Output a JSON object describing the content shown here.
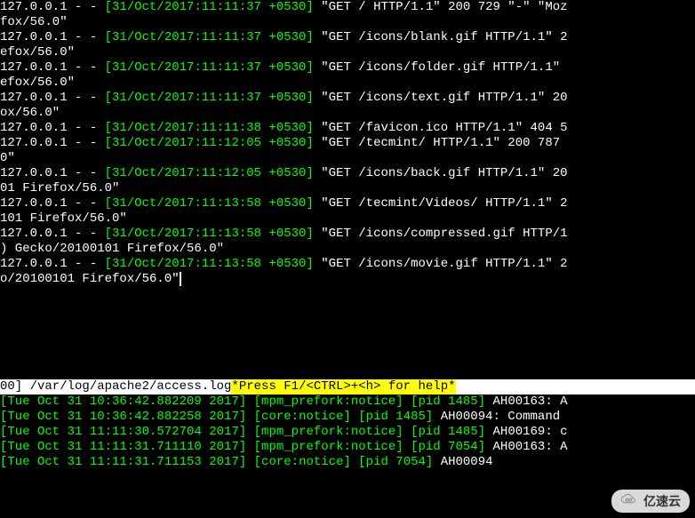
{
  "colors": {
    "bg": "#000000",
    "fg": "#ffffff",
    "green": "#00ff00",
    "status_bg": "#ffffff",
    "status_hl": "#ffff00"
  },
  "status_bar": {
    "left": "00] /var/log/apache2/access.log ",
    "right": "*Press F1/<CTRL>+<h> for help*"
  },
  "access_log": [
    {
      "prefix": "127.0.0.1 - - ",
      "timestamp": "[31/Oct/2017:11:11:37 +0530]",
      "tail": "  \"GET / HTTP/1.1\" 200 729 \"-\" \"Moz",
      "wrap": "fox/56.0\""
    },
    {
      "prefix": "127.0.0.1 - - ",
      "timestamp": "[31/Oct/2017:11:11:37 +0530]",
      "tail": "  \"GET /icons/blank.gif HTTP/1.1\" 2",
      "wrap": "efox/56.0\""
    },
    {
      "prefix": "127.0.0.1 - - ",
      "timestamp": "[31/Oct/2017:11:11:37 +0530]",
      "tail": "  \"GET /icons/folder.gif HTTP/1.1\" ",
      "wrap": "efox/56.0\""
    },
    {
      "prefix": "127.0.0.1 - - ",
      "timestamp": "[31/Oct/2017:11:11:37 +0530]",
      "tail": "  \"GET /icons/text.gif HTTP/1.1\" 20",
      "wrap": "ox/56.0\""
    },
    {
      "prefix": "127.0.0.1 - - ",
      "timestamp": "[31/Oct/2017:11:11:38 +0530]",
      "tail": "  \"GET /favicon.ico HTTP/1.1\" 404 5",
      "wrap": null
    },
    {
      "prefix": "127.0.0.1 - - ",
      "timestamp": "[31/Oct/2017:11:12:05 +0530]",
      "tail": "  \"GET /tecmint/ HTTP/1.1\" 200 787 ",
      "wrap": "0\""
    },
    {
      "prefix": "127.0.0.1 - - ",
      "timestamp": "[31/Oct/2017:11:12:05 +0530]",
      "tail": "  \"GET /icons/back.gif HTTP/1.1\" 20",
      "wrap": "01 Firefox/56.0\""
    },
    {
      "prefix": "127.0.0.1 - - ",
      "timestamp": "[31/Oct/2017:11:13:58 +0530]",
      "tail": "  \"GET /tecmint/Videos/ HTTP/1.1\" 2",
      "wrap": "101 Firefox/56.0\""
    },
    {
      "prefix": "127.0.0.1 - - ",
      "timestamp": "[31/Oct/2017:11:13:58 +0530]",
      "tail": "  \"GET /icons/compressed.gif HTTP/1",
      "wrap": ") Gecko/20100101 Firefox/56.0\""
    },
    {
      "prefix": "127.0.0.1 - - ",
      "timestamp": "[31/Oct/2017:11:13:58 +0530]",
      "tail": "  \"GET /icons/movie.gif HTTP/1.1\" 2",
      "wrap": "o/20100101 Firefox/56.0\""
    }
  ],
  "error_log": [
    {
      "ts": "[Tue Oct 31 10:36:42.882209 2017]",
      "module": "[mpm_prefork:notice]",
      "pid": "[pid 1485]",
      "tail": " AH00163: A"
    },
    {
      "ts": "[Tue Oct 31 10:36:42.882258 2017]",
      "module": "[core:notice]",
      "pid": "[pid 1485]",
      "tail": " AH00094: Command "
    },
    {
      "ts": "[Tue Oct 31 11:11:30.572704 2017]",
      "module": "[mpm_prefork:notice]",
      "pid": "[pid 1485]",
      "tail": " AH00169: c"
    },
    {
      "ts": "[Tue Oct 31 11:11:31.711110 2017]",
      "module": "[mpm_prefork:notice]",
      "pid": "[pid 7054]",
      "tail": " AH00163: A"
    },
    {
      "ts": "[Tue Oct 31 11:11:31.711153 2017]",
      "module": "[core:notice]",
      "pid": "[pid 7054]",
      "tail": " AH00094"
    }
  ],
  "watermark": "亿速云"
}
